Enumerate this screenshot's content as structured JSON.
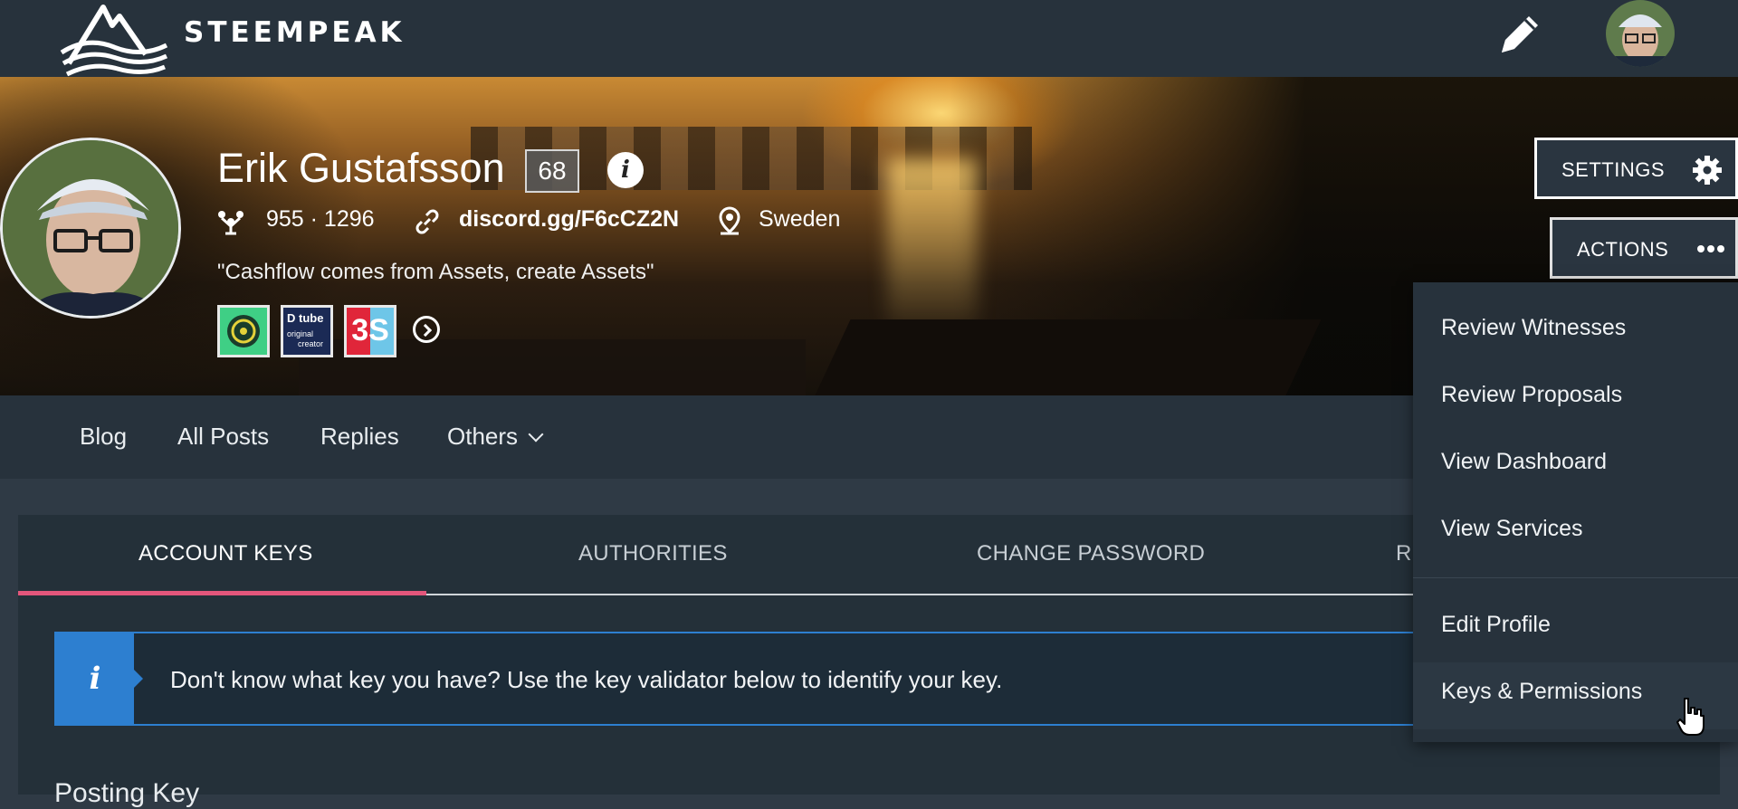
{
  "header": {
    "brand": "STEEMPEAK",
    "compose_icon": "pencil-icon",
    "user_avatar": "avatar"
  },
  "profile": {
    "name": "Erik Gustafsson",
    "reputation": "68",
    "followers_following": "955 · 1296",
    "website": "discord.gg/F6cCZ2N",
    "location": "Sweden",
    "about": "\"Cashflow comes from Assets, create Assets\"",
    "badges": [
      {
        "name": "green-badge"
      },
      {
        "name": "dtube-badge",
        "title": "D tube",
        "line1": "original",
        "line2": "creator"
      },
      {
        "name": "3s-badge",
        "text": "3S"
      }
    ]
  },
  "buttons": {
    "settings": "SETTINGS",
    "actions": "ACTIONS"
  },
  "nav": {
    "blog": "Blog",
    "all_posts": "All Posts",
    "replies": "Replies",
    "others": "Others"
  },
  "tabs": {
    "account_keys": "ACCOUNT KEYS",
    "authorities": "AUTHORITIES",
    "change_password": "CHANGE PASSWORD",
    "partial": "R"
  },
  "alert": {
    "text": "Don't know what key you have? Use the key validator below to identify your key."
  },
  "section": {
    "title": "Posting Key"
  },
  "dropdown": {
    "items": [
      "Review Witnesses",
      "Review Proposals",
      "View Dashboard",
      "View Services",
      "Edit Profile",
      "Keys & Permissions"
    ]
  },
  "colors": {
    "accent_tab": "#e3567b",
    "info_blue": "#2d7fd0",
    "topbar": "#27323c"
  }
}
